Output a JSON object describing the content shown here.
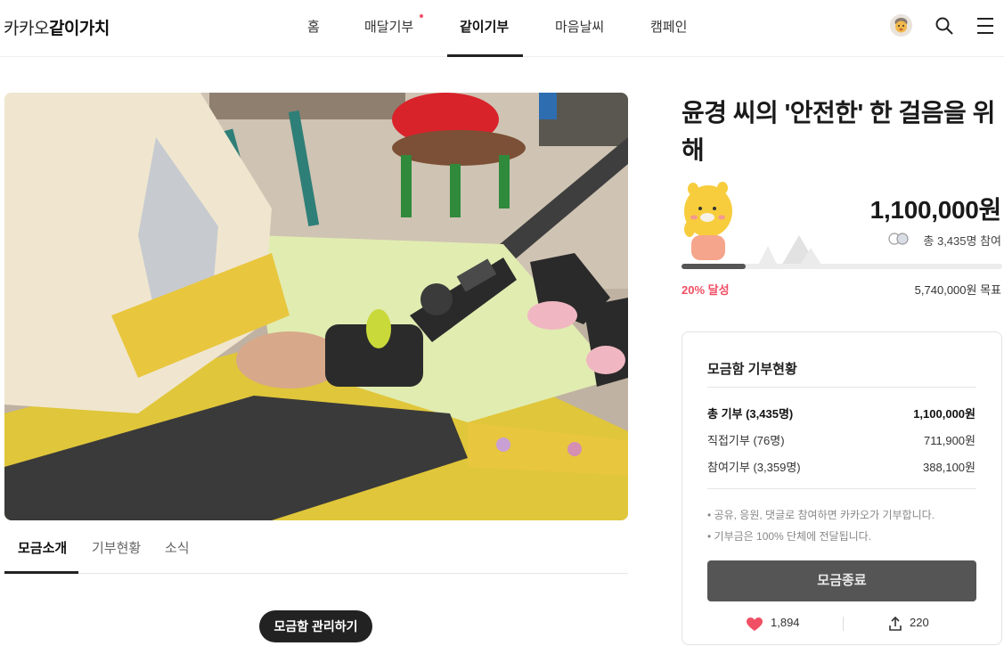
{
  "logo": {
    "part1": "카카오",
    "part2": "같이가치"
  },
  "nav": {
    "items": [
      {
        "label": "홈"
      },
      {
        "label": "매달기부"
      },
      {
        "label": "같이기부"
      },
      {
        "label": "마음날씨"
      },
      {
        "label": "캠페인"
      }
    ],
    "active_index": 2
  },
  "header_icons": [
    "avatar",
    "search-icon",
    "menu-icon"
  ],
  "content_tabs": [
    "모금소개",
    "기부현황",
    "소식"
  ],
  "manage_button": "모금함 관리하기",
  "campaign": {
    "title": "윤경 씨의 '안전한' 한 걸음을 위해",
    "amount": "1,100,000원",
    "participants": "총 3,435명 참여",
    "percent_text": "20% 달성",
    "progress_percent": 20,
    "goal": "5,740,000원 목표"
  },
  "status_card": {
    "title": "모금함 기부현황",
    "rows": [
      {
        "label": "총 기부 (3,435명)",
        "value": "1,100,000원"
      },
      {
        "label": "직접기부 (76명)",
        "value": "711,900원"
      },
      {
        "label": "참여기부 (3,359명)",
        "value": "388,100원"
      }
    ],
    "notes": [
      "• 공유, 응원, 댓글로 참여하면 카카오가 기부합니다.",
      "• 기부금은 100% 단체에 전달됩니다."
    ],
    "end_button": "모금종료",
    "likes": "1,894",
    "shares": "220"
  },
  "colors": {
    "accent_red": "#f04f64",
    "dark": "#222222",
    "button_gray": "#555555"
  }
}
